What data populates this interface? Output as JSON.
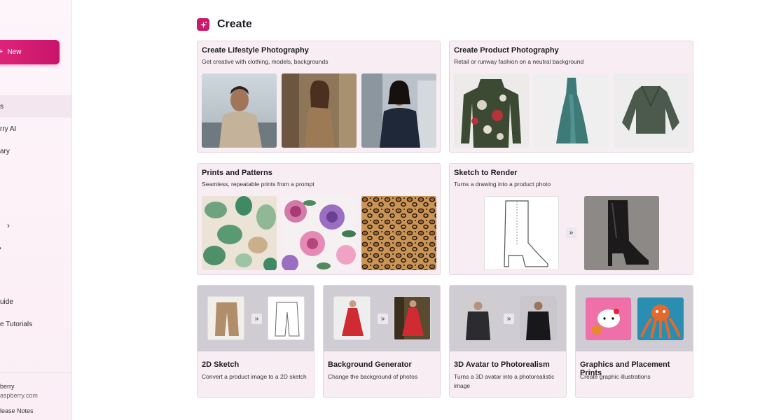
{
  "sidebar": {
    "new_button": "New",
    "items": [
      "s",
      "rry AI",
      "ary",
      "uide",
      "e Tutorials"
    ],
    "account_name": "berry",
    "account_email": "aspberry.com",
    "release_notes": "lease Notes"
  },
  "header": {
    "title": "Create"
  },
  "cards": {
    "lifestyle": {
      "title": "Create Lifestyle Photography",
      "subtitle": "Get creative with clothing, models, backgrounds"
    },
    "product": {
      "title": "Create Product Photography",
      "subtitle": "Retail or runway fashion on a neutral background"
    },
    "prints": {
      "title": "Prints and Patterns",
      "subtitle": "Seamless, repeatable prints from a prompt"
    },
    "sketch": {
      "title": "Sketch to Render",
      "subtitle": "Turns a drawing into a product photo"
    },
    "sketch2d": {
      "title": "2D Sketch",
      "subtitle": "Convert a product image to a 2D sketch"
    },
    "background": {
      "title": "Background Generator",
      "subtitle": "Change the background of photos"
    },
    "avatar": {
      "title": "3D Avatar to Photorealism",
      "subtitle": "Turns a 3D avatar into a photorealistic image"
    },
    "graphics": {
      "title": "Graphics and Placement Prints",
      "subtitle": "Create graphic illustrations"
    }
  },
  "icons": {
    "sparkle": "sparkle-icon",
    "plus": "plus-icon",
    "chevron": "chevron-right-icon",
    "arrow": "double-chevron-right-icon"
  },
  "colors": {
    "accent": "#c81a6e",
    "card_bg": "#f8edf3"
  }
}
